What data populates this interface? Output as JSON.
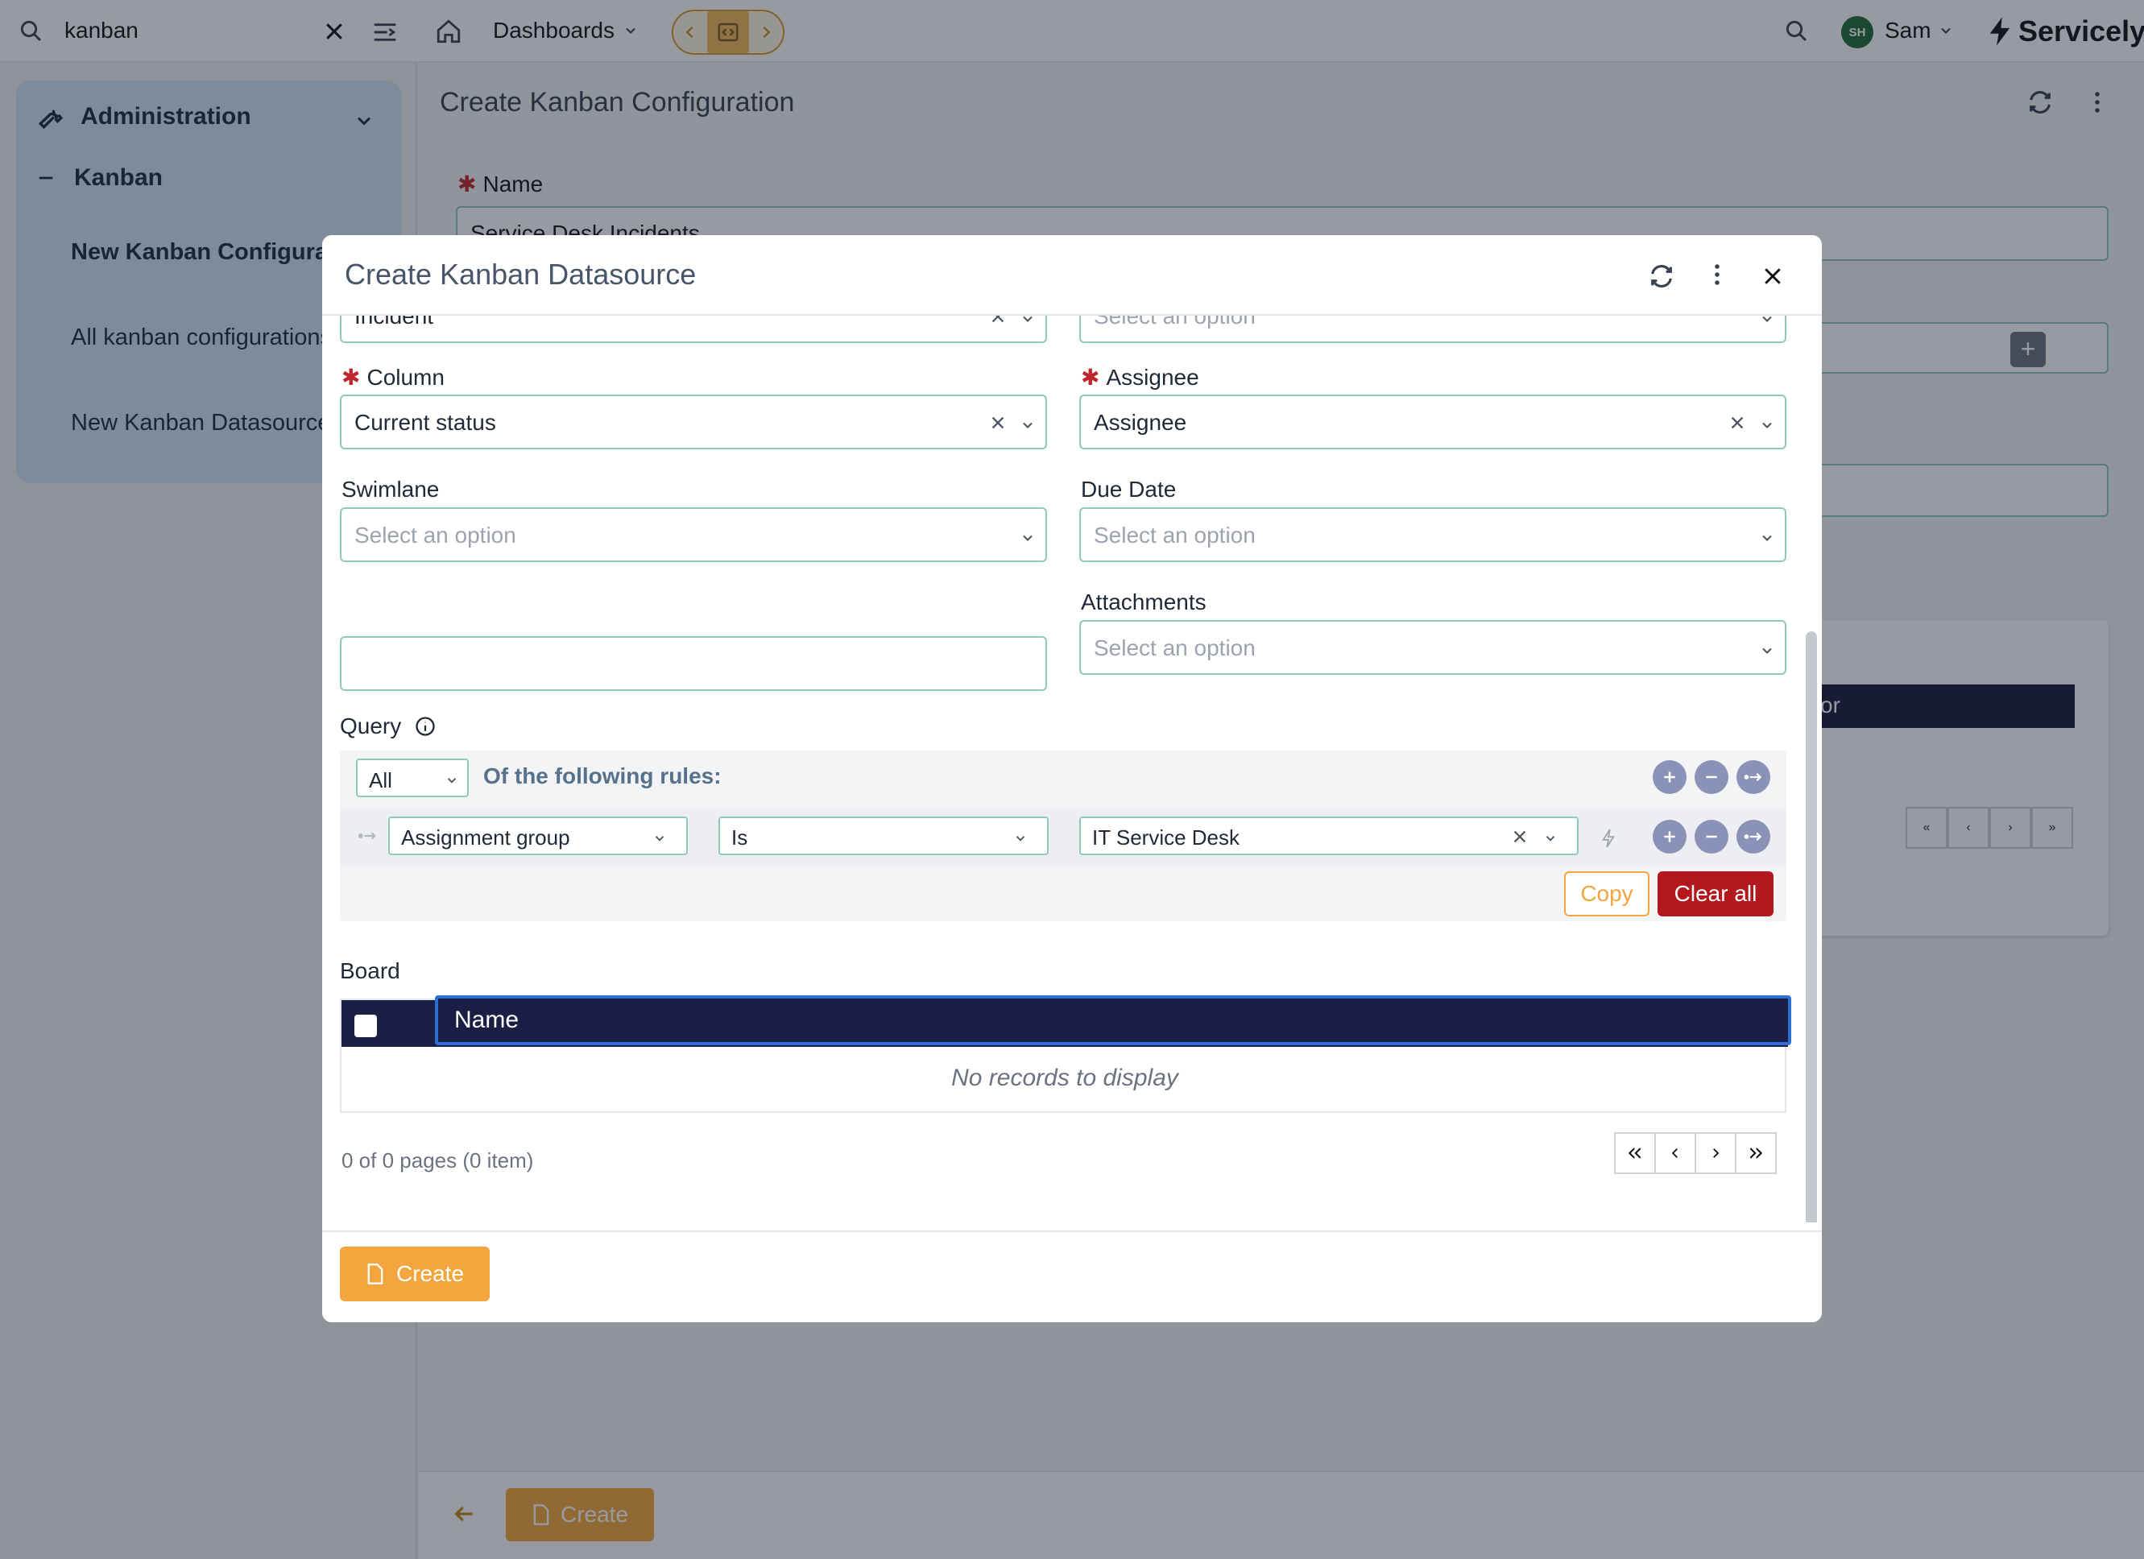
{
  "search": {
    "value": "kanban"
  },
  "topbar": {
    "dashboards_label": "Dashboards",
    "user_initials": "SH",
    "user_name": "Sam",
    "brand_name": "Servicely"
  },
  "sidebar": {
    "section_label": "Administration",
    "group_label": "Kanban",
    "items": [
      {
        "label": "New Kanban Configuration"
      },
      {
        "label": "All kanban configurations"
      },
      {
        "label": "New Kanban Datasource"
      }
    ]
  },
  "page": {
    "title": "Create Kanban Configuration",
    "name_label": "Name",
    "name_value": "Service Desk Incidents",
    "panel_header_partial": "or",
    "create_label": "Create"
  },
  "modal": {
    "title": "Create Kanban Datasource",
    "top_left_value": "Incident",
    "top_right_placeholder": "Select an option",
    "column": {
      "label": "Column",
      "value": "Current status"
    },
    "assignee": {
      "label": "Assignee",
      "value": "Assignee"
    },
    "swimlane": {
      "label": "Swimlane",
      "placeholder": "Select an option"
    },
    "due_date": {
      "label": "Due Date",
      "placeholder": "Select an option"
    },
    "attachments": {
      "label": "Attachments",
      "placeholder": "Select an option"
    },
    "query": {
      "label": "Query",
      "match": "All",
      "rules_label": "Of the following rules:",
      "rule": {
        "field": "Assignment group",
        "operator": "Is",
        "value": "IT Service Desk"
      },
      "copy_label": "Copy",
      "clear_label": "Clear all"
    },
    "board": {
      "label": "Board",
      "column_header": "Name",
      "empty_text": "No records to display",
      "page_info": "0 of 0 pages (0 item)"
    },
    "create_label": "Create"
  },
  "colors": {
    "accent": "#f2a63d",
    "danger": "#b3181f",
    "field_border": "#8cc9b6",
    "grid_header": "#1b1f45",
    "sidebar_bg": "#cfe6f5"
  }
}
